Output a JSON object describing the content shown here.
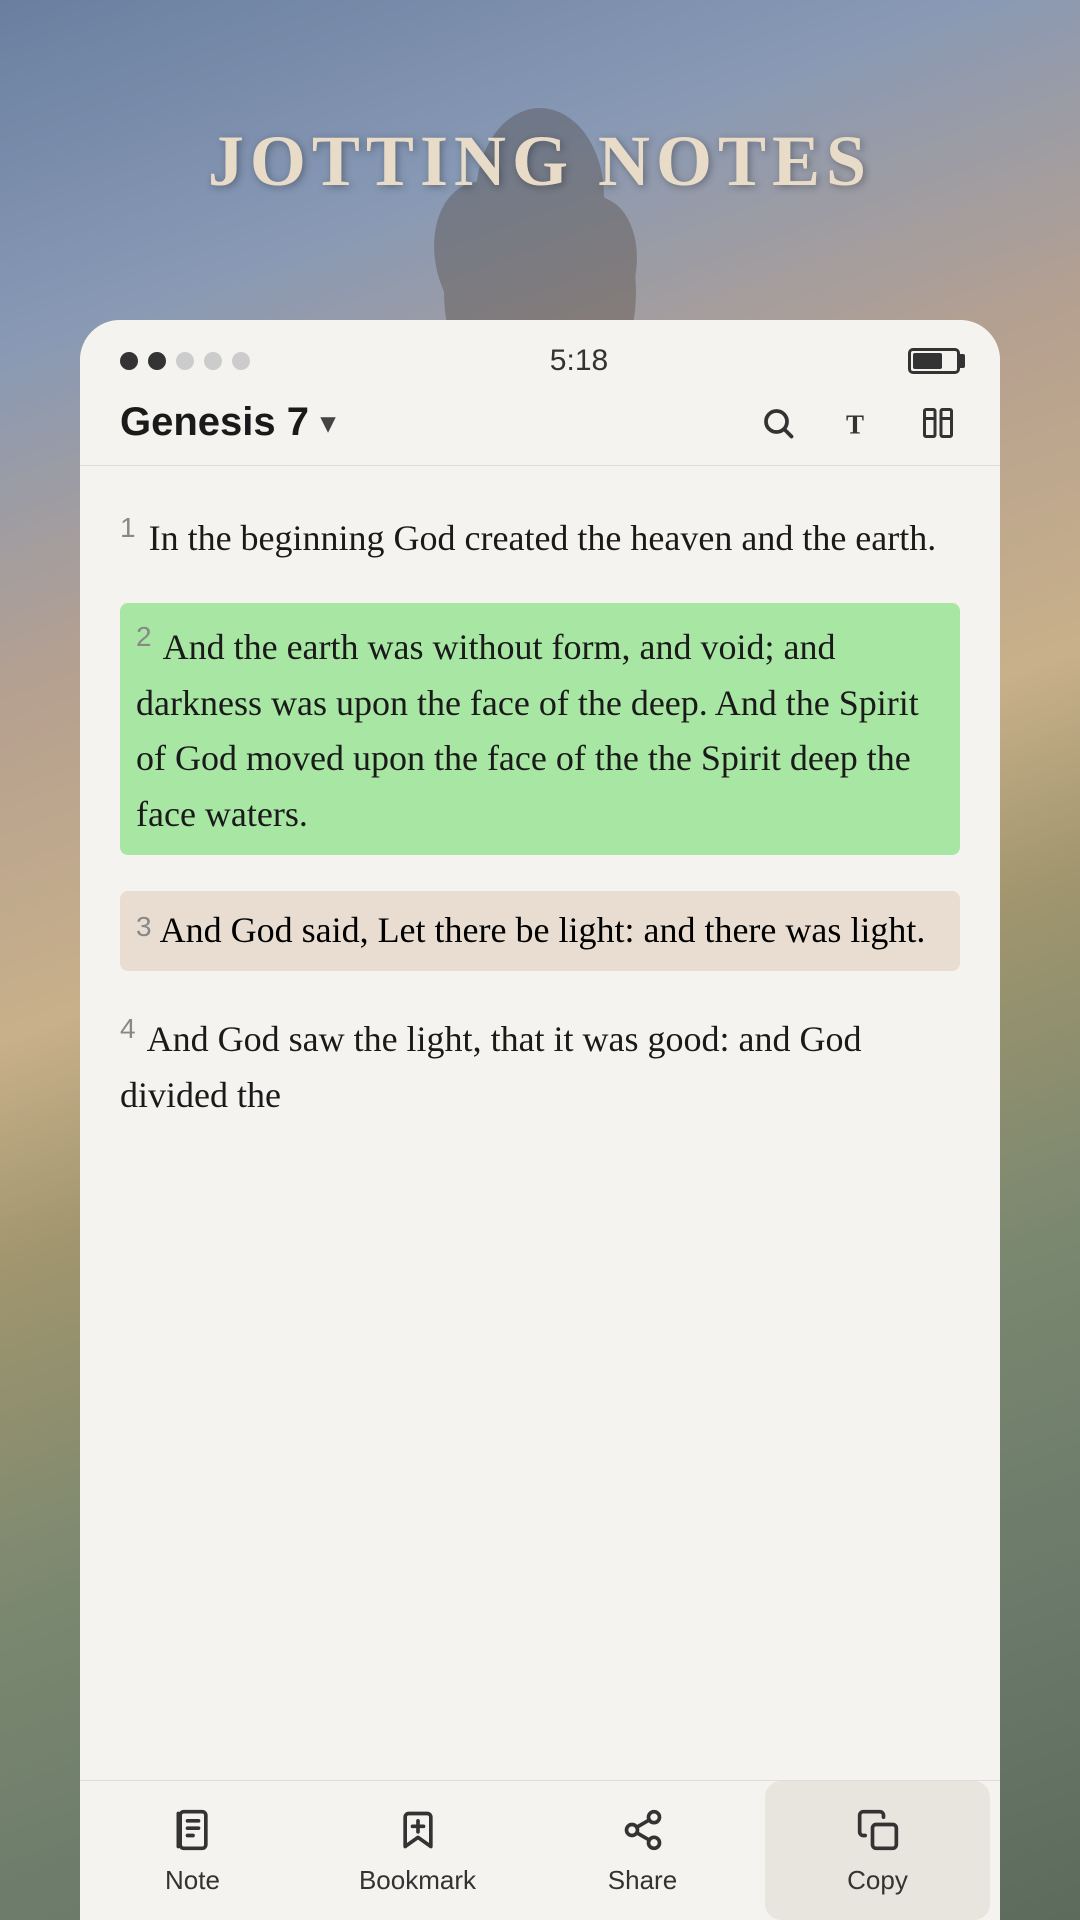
{
  "app": {
    "title": "JOTTING NOTES"
  },
  "status_bar": {
    "time": "5:18",
    "dots": [
      "filled",
      "filled",
      "empty",
      "empty",
      "empty"
    ]
  },
  "header": {
    "chapter": "Genesis 7",
    "chevron": "▾",
    "icons": [
      "search",
      "text-format",
      "compare"
    ]
  },
  "verses": [
    {
      "number": "1",
      "text": "In the beginning God created the heaven and the earth.",
      "highlight": false,
      "bg": false
    },
    {
      "number": "2",
      "text": "And the earth was without form, and void; and darkness was upon the face of the deep. And the Spirit of God moved upon the face of the the Spirit deep the face waters.",
      "highlight": true,
      "bg": false
    },
    {
      "number": "3",
      "text": "And God said, Let there be light: and there was light.",
      "highlight": false,
      "bg": true
    },
    {
      "number": "4",
      "text": "And God saw the light, that it was good: and God divided the",
      "highlight": false,
      "bg": false
    }
  ],
  "toolbar": {
    "items": [
      {
        "id": "note",
        "label": "Note",
        "active": false
      },
      {
        "id": "bookmark",
        "label": "Bookmark",
        "active": false
      },
      {
        "id": "share",
        "label": "Share",
        "active": false
      },
      {
        "id": "copy",
        "label": "Copy",
        "active": true
      }
    ]
  }
}
